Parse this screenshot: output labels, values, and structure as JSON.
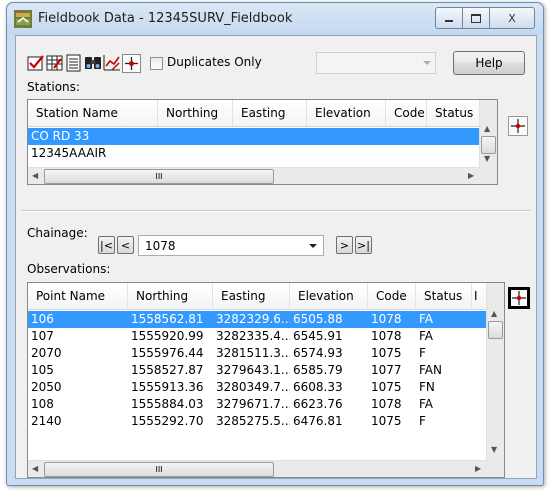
{
  "window": {
    "title": "Fieldbook Data - 12345SURV_Fieldbook",
    "minimize_icon": "minimize-icon",
    "maximize_icon": "maximize-icon",
    "close_label": "X"
  },
  "toolbar": {
    "icons": [
      "check-edit-icon",
      "table-edit-icon",
      "list-icon",
      "binoculars-icon",
      "chart-edit-icon",
      "target-icon"
    ],
    "duplicates_only_label": "Duplicates Only",
    "duplicates_only_checked": false,
    "filter_value": "",
    "help_label": "Help"
  },
  "stations": {
    "label": "Stations:",
    "columns": [
      "Station Name",
      "Northing",
      "Easting",
      "Elevation",
      "Code",
      "Status"
    ],
    "rows": [
      [
        "CO RD 33",
        "",
        "",
        "",
        "",
        ""
      ],
      [
        "12345AAAIR",
        "",
        "",
        "",
        "",
        ""
      ]
    ],
    "selected_row": 0,
    "scroll_grip": "III"
  },
  "chainage": {
    "label": "Chainage:",
    "value": "1078",
    "first_label": "|<",
    "prev_label": "<",
    "next_label": ">",
    "last_label": ">|"
  },
  "observations": {
    "label": "Observations:",
    "columns": [
      "Point Name",
      "Northing",
      "Easting",
      "Elevation",
      "Code",
      "Status",
      "I"
    ],
    "rows": [
      [
        "106",
        "1558562.81",
        "3282329.6...",
        "6505.88",
        "1078",
        "FA"
      ],
      [
        "107",
        "1555920.99",
        "3282335.4...",
        "6545.91",
        "1078",
        "FA"
      ],
      [
        "2070",
        "1555976.44",
        "3281511.3...",
        "6574.93",
        "1075",
        "F"
      ],
      [
        "105",
        "1558527.87",
        "3279643.1...",
        "6585.79",
        "1077",
        "FAN"
      ],
      [
        "2050",
        "1555913.36",
        "3280349.7...",
        "6608.33",
        "1075",
        "FN"
      ],
      [
        "108",
        "1555884.03",
        "3279671.7...",
        "6623.76",
        "1078",
        "FA"
      ],
      [
        "2140",
        "1555292.70",
        "3285275.5...",
        "6476.81",
        "1075",
        "F"
      ]
    ],
    "selected_row": 0,
    "scroll_grip": "III"
  },
  "colors": {
    "selection": "#3399ff",
    "highlight_border": "#000000"
  }
}
